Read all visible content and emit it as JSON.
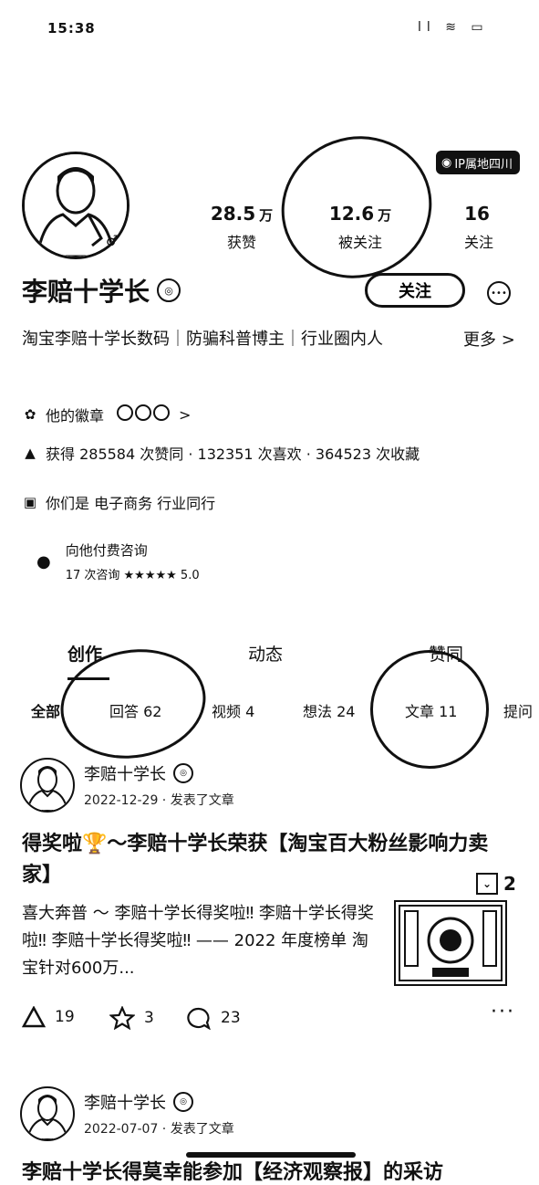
{
  "status_bar": {
    "time": "15:38",
    "icons": "ll ≋ ▭"
  },
  "profile": {
    "location": "IP属地四川",
    "gender_symbol": "♂",
    "stats": [
      {
        "value": "28.5",
        "unit": "万",
        "label": "获赞"
      },
      {
        "value": "12.6",
        "unit": "万",
        "label": "被关注"
      },
      {
        "value": "16",
        "unit": "",
        "label": "关注"
      }
    ],
    "name": "李赔十学长",
    "follow_label": "关注",
    "bio": "淘宝李赔十学长数码｜防骗科普博主｜行业圈内人",
    "more_label": "更多 >",
    "badges_label": "他的徽章",
    "badges_arrow": ">",
    "achievement": "获得 285584 次赞同 · 132351 次喜欢 · 364523 次收藏",
    "mutual": "你们是 电子商务 行业同行",
    "consult_title": "向他付费咨询",
    "consult_meta": "17 次咨询  ★★★★★ 5.0"
  },
  "tabs": [
    "创作",
    "动态",
    "赞同"
  ],
  "subtabs": [
    "全部",
    "回答 62",
    "视频 4",
    "想法 24",
    "文章 11",
    "提问"
  ],
  "post": {
    "author": "李赔十学长",
    "date": "2022-12-29 · 发表了文章",
    "title": "得奖啦🏆～李赔十学长荣获【淘宝百大粉丝影响力卖家】",
    "excerpt": "喜大奔普 ～ 李赔十学长得奖啦‼ 李赔十学长得奖啦‼ 李赔十学长得奖啦‼ —— 2022 年度榜单 淘宝针对600万...",
    "fav_count": "2",
    "likes": "19",
    "stars": "3",
    "comments": "23"
  },
  "post2": {
    "author": "李赔十学长",
    "date": "2022-07-07 · 发表了文章",
    "title_cut": "李赔十学长得莫幸能参加【经济观察报】的采访"
  }
}
